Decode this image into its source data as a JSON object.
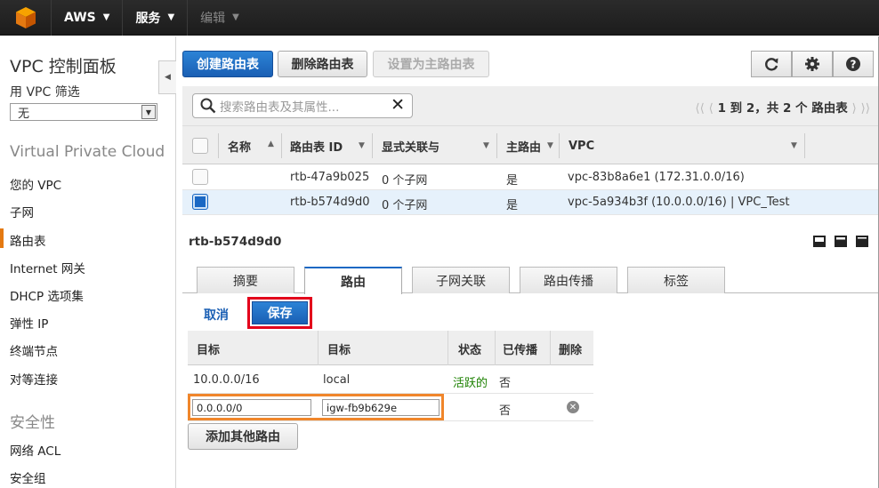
{
  "topnav": {
    "brand": "AWS",
    "services": "服务",
    "edit": "编辑"
  },
  "sidebar": {
    "title": "VPC 控制面板",
    "filter_label": "用 VPC 筛选",
    "filter_value": "无",
    "section_vpc": "Virtual Private Cloud",
    "items_vpc": [
      "您的 VPC",
      "子网",
      "路由表",
      "Internet 网关",
      "DHCP 选项集",
      "弹性 IP",
      "终端节点",
      "对等连接"
    ],
    "active_item": "路由表",
    "section_security": "安全性",
    "items_security": [
      "网络 ACL",
      "安全组"
    ]
  },
  "toolbar": {
    "create": "创建路由表",
    "delete": "删除路由表",
    "set_main": "设置为主路由表",
    "refresh_icon": "refresh-icon",
    "settings_icon": "gear-icon",
    "help_icon": "help-icon"
  },
  "search": {
    "placeholder": "搜索路由表及其属性..."
  },
  "pager": {
    "text": "1 到 2，共 2 个 路由表"
  },
  "table": {
    "columns": [
      "名称",
      "路由表 ID",
      "显式关联与",
      "主路由",
      "VPC"
    ],
    "rows": [
      {
        "name": "",
        "id": "rtb-47a9b025",
        "assoc": "0 个子网",
        "main": "是",
        "vpc": "vpc-83b8a6e1 (172.31.0.0/16)",
        "selected": false
      },
      {
        "name": "",
        "id": "rtb-b574d9d0",
        "assoc": "0 个子网",
        "main": "是",
        "vpc": "vpc-5a934b3f (10.0.0.0/16) | VPC_Test",
        "selected": true
      }
    ]
  },
  "detail": {
    "title": "rtb-b574d9d0",
    "tabs": [
      "摘要",
      "路由",
      "子网关联",
      "路由传播",
      "标签"
    ],
    "active_tab": "路由",
    "cancel": "取消",
    "save": "保存",
    "route_columns": [
      "目标",
      "目标",
      "状态",
      "已传播",
      "删除"
    ],
    "routes": [
      {
        "destination": "10.0.0.0/16",
        "target": "local",
        "status": "活跃的",
        "propagated": "否"
      }
    ],
    "edit_row": {
      "destination": "0.0.0.0/0",
      "target": "igw-fb9b629e",
      "propagated": "否"
    },
    "add_route": "添加其他路由"
  },
  "colors": {
    "primary": "#1a68c4",
    "highlight_save": "#e3001b",
    "highlight_edit": "#f0862b",
    "active_status": "#1d8102",
    "nav_accent": "#e47911"
  }
}
